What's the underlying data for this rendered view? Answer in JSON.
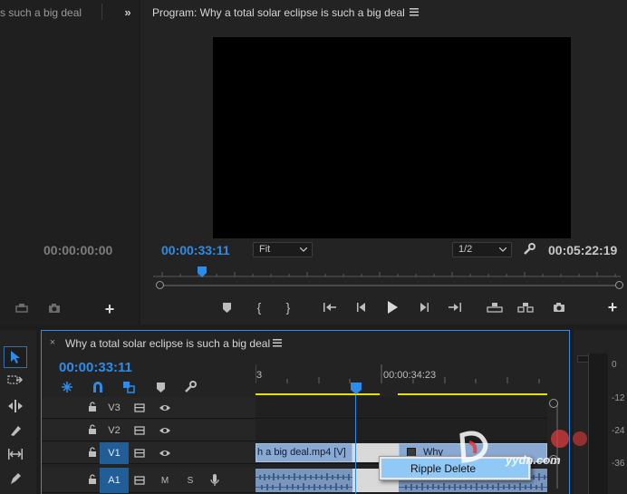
{
  "source_panel": {
    "title": "s such a big deal",
    "timecode": "00:00:00:00"
  },
  "program_panel": {
    "title": "Program: Why a total solar eclipse is such a big deal",
    "timecode_current": "00:00:33:11",
    "fit_label": "Fit",
    "resolution_label": "1/2",
    "timecode_duration": "00:05:22:19",
    "playhead_position_fraction": 0.105
  },
  "timeline_panel": {
    "sequence_tab": "Why a total solar eclipse is such a big deal",
    "timecode": "00:00:33:11",
    "ruler_marks": [
      "3",
      "00:00:34:23"
    ],
    "tracks": [
      {
        "name": "V3",
        "active": false
      },
      {
        "name": "V2",
        "active": false
      },
      {
        "name": "V1",
        "active": true
      },
      {
        "name": "A1",
        "active": true
      }
    ],
    "clip_v1_left": "h a big deal.mp4 [V]",
    "clip_v1_right": "Why",
    "context_menu_item": "Ripple Delete"
  },
  "audio_meter": {
    "labels": [
      "0",
      "-12",
      "-24",
      "-36"
    ]
  },
  "watermark": {
    "text": "yydn.com"
  },
  "colors": {
    "accent_blue": "#2d8ceb",
    "track_active": "#215d96",
    "clip_blue": "#8aa9d2",
    "work_area_yellow": "#e8e000"
  }
}
